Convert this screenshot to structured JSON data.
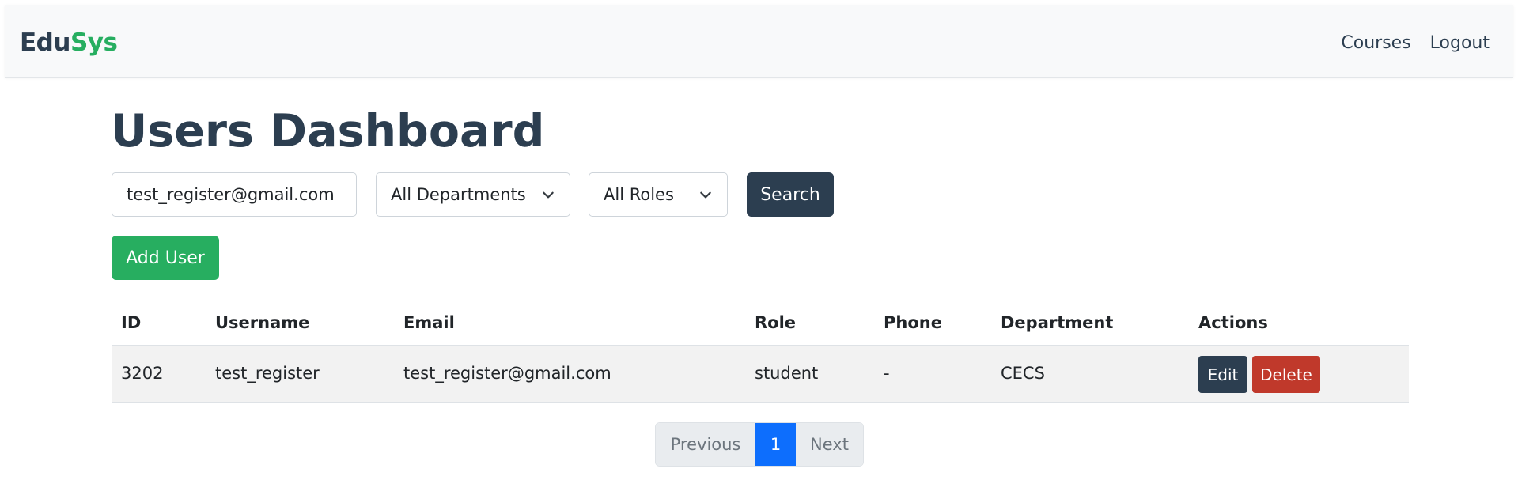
{
  "brand": {
    "part1": "Edu",
    "part2": "Sys"
  },
  "nav": {
    "courses": "Courses",
    "logout": "Logout"
  },
  "page_title": "Users Dashboard",
  "filters": {
    "search_value": "test_register@gmail.com",
    "department": "All Departments",
    "role": "All Roles",
    "search_label": "Search"
  },
  "add_user_label": "Add User",
  "table": {
    "headers": [
      "ID",
      "Username",
      "Email",
      "Role",
      "Phone",
      "Department",
      "Actions"
    ],
    "rows": [
      {
        "id": "3202",
        "username": "test_register",
        "email": "test_register@gmail.com",
        "role": "student",
        "phone": "-",
        "department": "CECS",
        "edit": "Edit",
        "delete": "Delete"
      }
    ]
  },
  "pagination": {
    "previous": "Previous",
    "current": "1",
    "next": "Next"
  },
  "colors": {
    "primary": "#2c3e50",
    "accent": "#27ae60",
    "danger": "#c0392b",
    "active_page": "#0d6efd"
  }
}
